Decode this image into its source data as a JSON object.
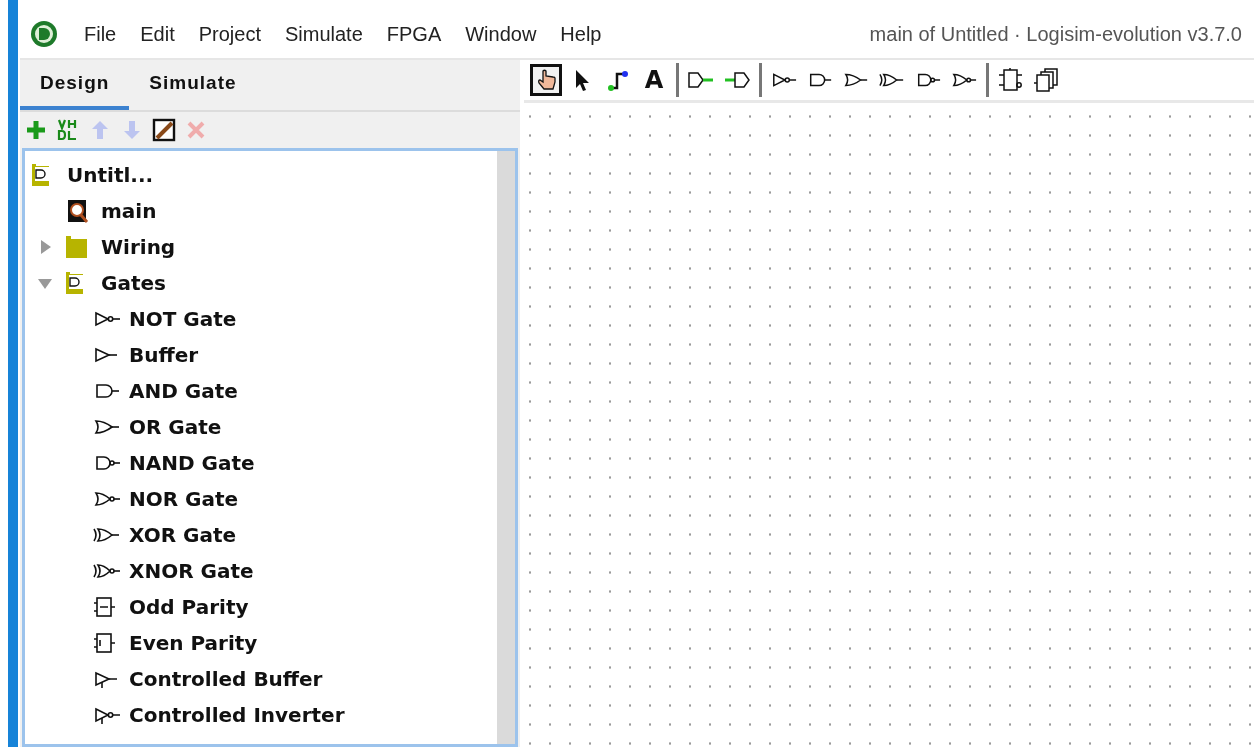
{
  "window": {
    "title": "main of Untitled · Logisim-evolution v3.7.0"
  },
  "menu": [
    "File",
    "Edit",
    "Project",
    "Simulate",
    "FPGA",
    "Window",
    "Help"
  ],
  "tabs": [
    {
      "label": "Design",
      "selected": true
    },
    {
      "label": "Simulate",
      "selected": false
    }
  ],
  "explorer_tools": [
    {
      "kind": "add",
      "disabled": false
    },
    {
      "kind": "vhdl",
      "disabled": false
    },
    {
      "kind": "up",
      "disabled": true
    },
    {
      "kind": "down",
      "disabled": true
    },
    {
      "kind": "appearance",
      "disabled": false
    },
    {
      "kind": "delete",
      "disabled": true
    }
  ],
  "tree": [
    {
      "label": "Untitl...",
      "kind": "library",
      "children": [
        {
          "label": "main",
          "kind": "circuit"
        },
        {
          "label": "Wiring",
          "kind": "folder",
          "expanded": false
        },
        {
          "label": "Gates",
          "kind": "library",
          "expanded": true,
          "children": [
            {
              "label": "NOT Gate",
              "kind": "not"
            },
            {
              "label": "Buffer",
              "kind": "buffer"
            },
            {
              "label": "AND Gate",
              "kind": "and"
            },
            {
              "label": "OR Gate",
              "kind": "or"
            },
            {
              "label": "NAND Gate",
              "kind": "nand"
            },
            {
              "label": "NOR Gate",
              "kind": "nor"
            },
            {
              "label": "XOR Gate",
              "kind": "xor"
            },
            {
              "label": "XNOR Gate",
              "kind": "xnor"
            },
            {
              "label": "Odd Parity",
              "kind": "odd-parity"
            },
            {
              "label": "Even Parity",
              "kind": "even-parity"
            },
            {
              "label": "Controlled Buffer",
              "kind": "controlled-buffer"
            },
            {
              "label": "Controlled Inverter",
              "kind": "controlled-inverter"
            }
          ]
        }
      ]
    }
  ],
  "toolbar": [
    [
      {
        "kind": "poke",
        "selected": true
      },
      {
        "kind": "select",
        "selected": false
      },
      {
        "kind": "wire",
        "selected": false
      },
      {
        "kind": "text",
        "glyph": "A",
        "selected": false
      }
    ],
    [
      {
        "kind": "output-pin"
      },
      {
        "kind": "input-pin"
      }
    ],
    [
      {
        "kind": "not"
      },
      {
        "kind": "and"
      },
      {
        "kind": "or"
      },
      {
        "kind": "xor"
      },
      {
        "kind": "nand"
      },
      {
        "kind": "nor"
      }
    ],
    [
      {
        "kind": "flip-flop"
      },
      {
        "kind": "subcircuit"
      }
    ]
  ]
}
